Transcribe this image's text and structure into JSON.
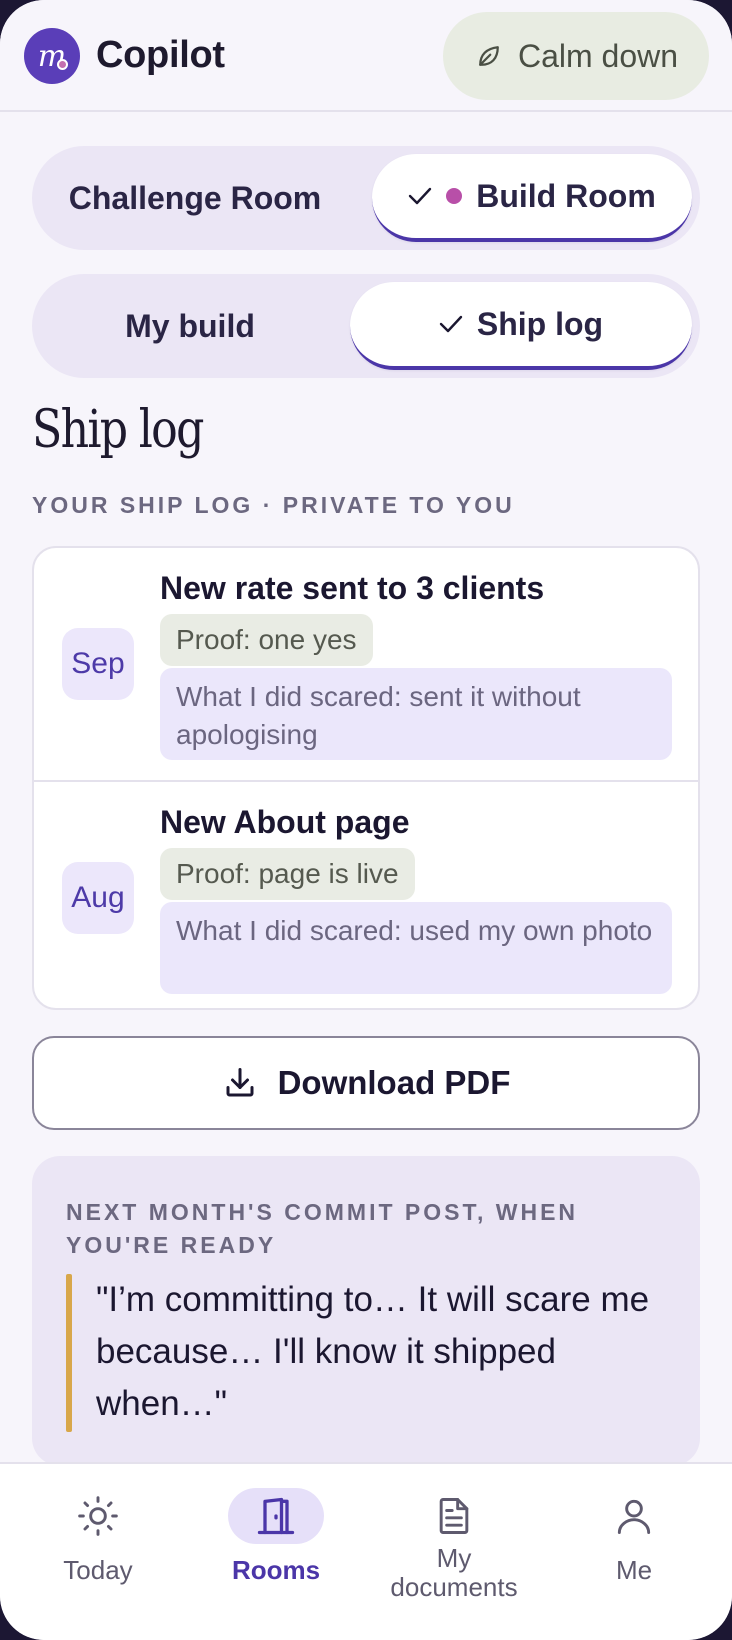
{
  "header": {
    "logo_glyph": "m",
    "app_title": "Copilot",
    "calm_button": "Calm down",
    "calm_icon": "leaf-icon"
  },
  "room_switch": {
    "options": [
      "Challenge Room",
      "Build Room"
    ],
    "active": "Build Room",
    "active_dot_color": "#b84fa8"
  },
  "view_switch": {
    "options": [
      "My build",
      "Ship log"
    ],
    "active": "Ship log"
  },
  "page": {
    "title": "Ship log",
    "eyebrow": "YOUR SHIP LOG · PRIVATE TO YOU"
  },
  "entries": [
    {
      "month": "Sep",
      "title": "New rate sent to 3 clients",
      "proof": "Proof: one yes",
      "scared": "What I did scared: sent it without apologising"
    },
    {
      "month": "Aug",
      "title": "New About page",
      "proof": "Proof: page is live",
      "scared": "What I did scared: used my own photo"
    }
  ],
  "download": {
    "label": "Download PDF",
    "icon": "download-icon"
  },
  "commit": {
    "eyebrow": "NEXT MONTH'S COMMIT POST, WHEN YOU'RE READY",
    "quote": "\"I’m committing to… It will scare me because… I'll know it shipped when…\""
  },
  "nav": [
    {
      "label": "Today",
      "icon": "sun-icon"
    },
    {
      "label": "Rooms",
      "icon": "door-icon",
      "active": true
    },
    {
      "label": "My documents",
      "icon": "document-icon"
    },
    {
      "label": "Me",
      "icon": "person-icon"
    }
  ],
  "colors": {
    "accent": "#4b36a8",
    "background": "#f7f5fb",
    "quote_bar": "#d8a74a"
  }
}
